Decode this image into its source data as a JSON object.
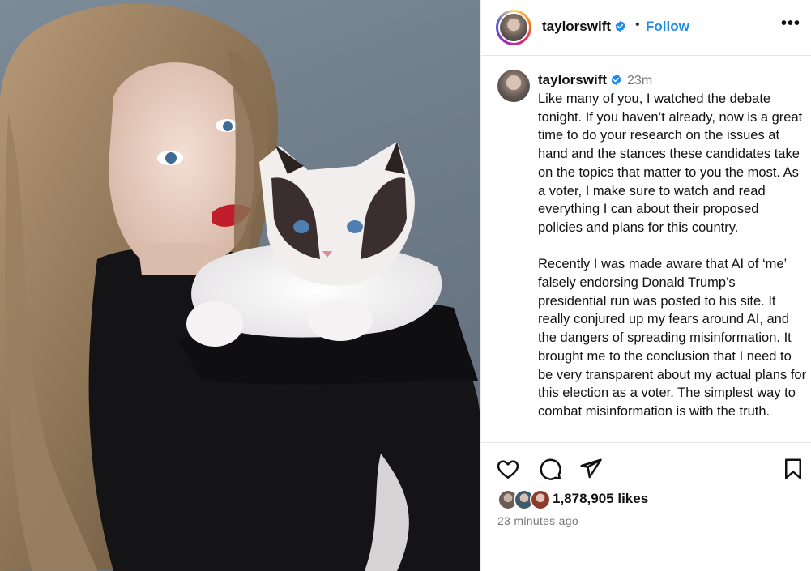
{
  "post": {
    "username": "taylorswift",
    "separator": "•",
    "follow_label": "Follow",
    "more_label": "•••",
    "photo_alt": "photo",
    "caption_time": "23m",
    "caption_paragraphs": [
      "Like many of you, I watched the debate tonight. If you haven’t already, now is a great time to do your research on the issues at hand and the stances these candidates take on the topics that matter to you the most. As a voter, I make sure to watch and read everything I can about their proposed policies and plans for this country.",
      "Recently I was made aware that AI of ‘me’ falsely endorsing Donald Trump’s presidential run was posted to his site. It really conjured up my fears around AI, and the dangers of spreading misinformation. It brought me to the conclusion that I need to be very transparent about my actual plans for this election as a voter. The simplest way to combat misinformation is with the truth."
    ],
    "likes": "1,878,905 likes",
    "time_ago": "23 minutes ago"
  },
  "icons": {
    "verified": "verified-badge-icon",
    "like": "heart-icon",
    "comment": "comment-icon",
    "share": "paper-plane-icon",
    "save": "bookmark-icon"
  },
  "colors": {
    "accent": "#1d8de8",
    "verified": "#1d8de8",
    "muted": "#777777"
  }
}
